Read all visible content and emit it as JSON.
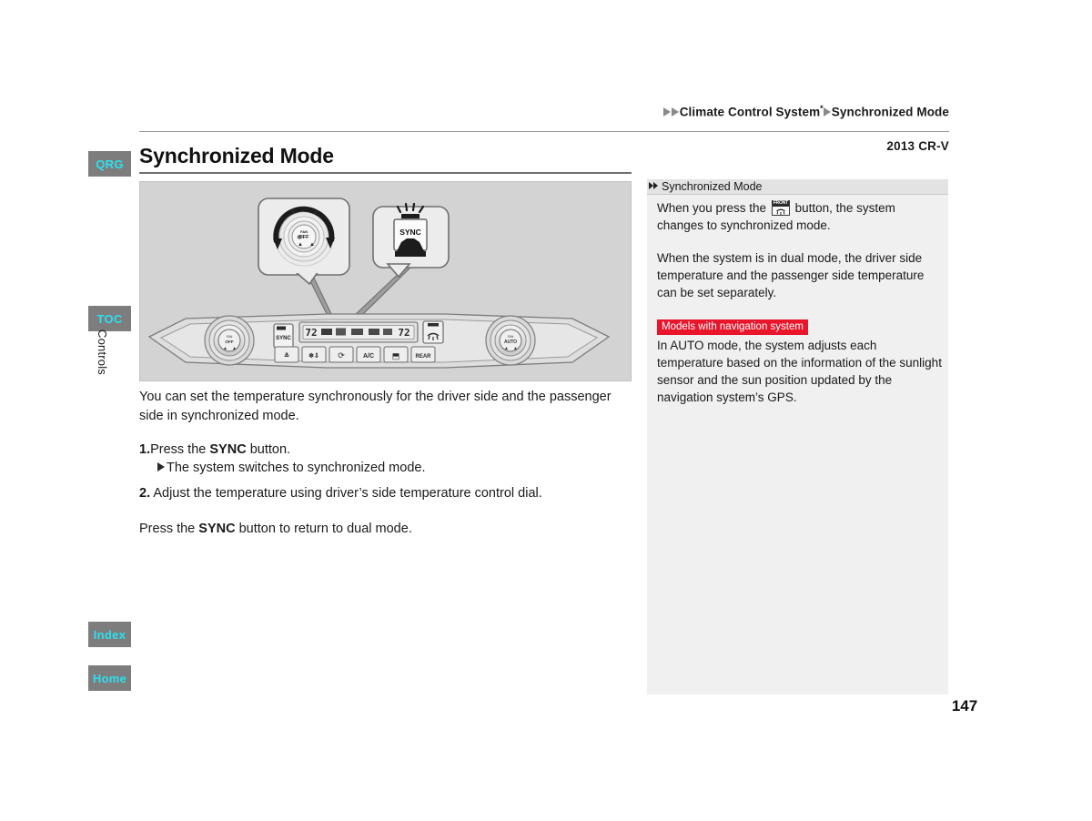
{
  "breadcrumb": {
    "item1": "Climate Control System",
    "superscript": "*",
    "item2": "Synchronized Mode"
  },
  "model_year": "2013 CR-V",
  "page_title": "Synchronized Mode",
  "page_number": "147",
  "left_tabs": [
    {
      "id": "qrg",
      "label": "QRG"
    },
    {
      "id": "toc",
      "label": "TOC"
    },
    {
      "id": "index",
      "label": "Index"
    },
    {
      "id": "home",
      "label": "Home"
    }
  ],
  "section_tab": "Controls",
  "illustration": {
    "callout_left_label": "temperature-control-dial",
    "callout_right_label": "SYNC",
    "panel_display_driver_temp": "72",
    "panel_display_passenger_temp": "72",
    "panel_sync_button": "SYNC",
    "panel_right_dial": "AUTO",
    "panel_left_dial": "OFF"
  },
  "body": {
    "intro": "You can set the temperature synchronously for the driver side and the passenger side in synchronized mode.",
    "step1_number": "1.",
    "step1_pre": "Press the ",
    "step1_bold": "SYNC",
    "step1_post": " button.",
    "step1_result": "The system switches to synchronized mode.",
    "step2_number": "2.",
    "step2_text": "Adjust the temperature using driver’s side temperature control dial.",
    "closing_pre": "Press the ",
    "closing_bold": "SYNC",
    "closing_post": " button to return to dual mode."
  },
  "side_panel": {
    "header": "Synchronized Mode",
    "para1_pre": "When you press the ",
    "para1_icon": "front-defroster-icon",
    "para1_post": " button, the system changes to synchronized mode.",
    "para2": "When the system is in dual mode, the driver side temperature and the passenger side temperature can be set separately.",
    "badge": "Models with navigation system",
    "para3": "In AUTO mode, the system adjusts each temperature based on the information of the sunlight sensor and the sun position updated by the navigation system’s GPS."
  },
  "colors": {
    "tab_bg": "#7d7d7d",
    "tab_text": "#2ce0ef",
    "badge_bg": "#e8152b",
    "illustration_bg": "#d3d3d3",
    "side_panel_bg": "#f0f0f0"
  }
}
